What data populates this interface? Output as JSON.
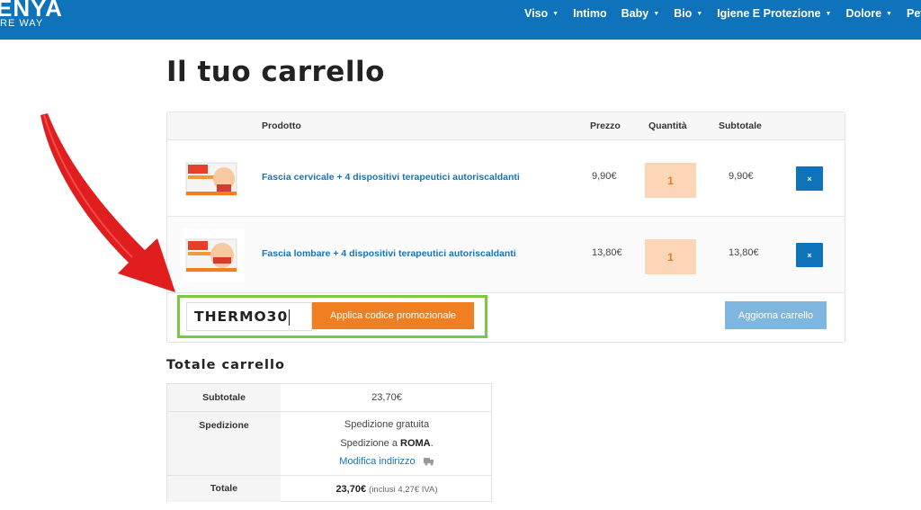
{
  "header": {
    "logo_line1": "ENYA",
    "logo_line2": "RE WAY",
    "nav": [
      {
        "label": "Viso",
        "caret": true
      },
      {
        "label": "Intimo",
        "caret": false
      },
      {
        "label": "Baby",
        "caret": true
      },
      {
        "label": "Bio",
        "caret": true
      },
      {
        "label": "Igiene E Protezione",
        "caret": true
      },
      {
        "label": "Dolore",
        "caret": true
      },
      {
        "label": "Pet",
        "caret": false
      }
    ]
  },
  "page": {
    "title": "Il tuo carrello"
  },
  "cart": {
    "headers": {
      "product": "Prodotto",
      "price": "Prezzo",
      "quantity": "Quantità",
      "subtotal": "Subtotale"
    },
    "items": [
      {
        "name": "Fascia cervicale + 4 dispositivi terapeutici autoriscaldanti",
        "price": "9,90€",
        "qty": "1",
        "subtotal": "9,90€",
        "remove": "×"
      },
      {
        "name": "Fascia lombare + 4 dispositivi terapeutici autoriscaldanti",
        "price": "13,80€",
        "qty": "1",
        "subtotal": "13,80€",
        "remove": "×"
      }
    ],
    "coupon_value": "THERMO30",
    "apply_coupon_label": "Applica codice promozionale",
    "update_cart_label": "Aggiorna carrello"
  },
  "totals": {
    "title": "Totale carrello",
    "subtotal_label": "Subtotale",
    "subtotal_value": "23,70€",
    "shipping_label": "Spedizione",
    "shipping_method": "Spedizione gratuita",
    "shipping_to_prefix": "Spedizione a",
    "shipping_city": "ROMA",
    "shipping_to_suffix": ".",
    "change_address": "Modifica indirizzo",
    "total_label": "Totale",
    "total_value": "23,70€",
    "tax_note": "(inclusi 4,27€ IVA)"
  },
  "colors": {
    "brand": "#0f73bc",
    "accent": "#f07f22",
    "highlight": "#7ac943",
    "arrow": "#e01e1e"
  }
}
